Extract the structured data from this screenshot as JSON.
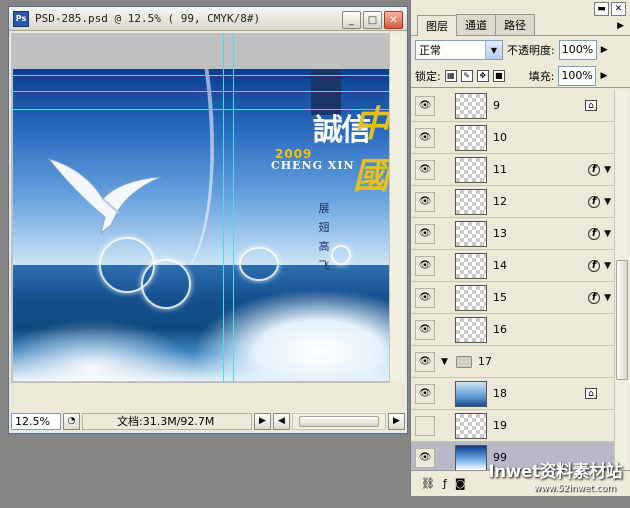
{
  "document": {
    "title": "PSD-285.psd @ 12.5% ( 99, CMYK/8#)",
    "logo": "Ps",
    "win_minimize": "_",
    "win_maximize": "□",
    "win_close": "✕",
    "artwork": {
      "year": "2009",
      "brand": "CHENG XIN",
      "title_white": "誠信",
      "title_gold": "中國",
      "vertical_text": [
        "展",
        "翅",
        "高",
        "飞"
      ]
    },
    "status": {
      "zoom": "12.5%",
      "doc_info": "文档:31.3M/92.7M"
    }
  },
  "palette": {
    "tabs": [
      {
        "label": "图层",
        "active": true
      },
      {
        "label": "通道",
        "active": false
      },
      {
        "label": "路径",
        "active": false
      }
    ],
    "blend_mode": "正常",
    "opacity_label": "不透明度:",
    "opacity_value": "100%",
    "lock_label": "锁定:",
    "fill_label": "填充:",
    "fill_value": "100%",
    "layers": [
      {
        "name": "9",
        "visible": true,
        "fx": false,
        "lock": true,
        "thumb": "transparent"
      },
      {
        "name": "10",
        "visible": true,
        "fx": false,
        "lock": false,
        "thumb": "transparent"
      },
      {
        "name": "11",
        "visible": true,
        "fx": true,
        "lock": false,
        "thumb": "transparent"
      },
      {
        "name": "12",
        "visible": true,
        "fx": true,
        "lock": false,
        "thumb": "transparent"
      },
      {
        "name": "13",
        "visible": true,
        "fx": true,
        "lock": false,
        "thumb": "transparent"
      },
      {
        "name": "14",
        "visible": true,
        "fx": true,
        "lock": false,
        "thumb": "transparent"
      },
      {
        "name": "15",
        "visible": true,
        "fx": true,
        "lock": false,
        "thumb": "transparent"
      },
      {
        "name": "16",
        "visible": true,
        "fx": false,
        "lock": false,
        "thumb": "transparent"
      },
      {
        "name": "17",
        "visible": true,
        "fx": false,
        "lock": false,
        "thumb": "folder"
      },
      {
        "name": "18",
        "visible": true,
        "fx": false,
        "lock": true,
        "thumb": "sea"
      },
      {
        "name": "19",
        "visible": false,
        "fx": false,
        "lock": false,
        "thumb": "transparent"
      },
      {
        "name": "99",
        "visible": true,
        "fx": false,
        "lock": false,
        "thumb": "background",
        "selected": true
      }
    ]
  },
  "watermark": {
    "text": "Inwet资料素材站",
    "url": "www.52inwet.com"
  },
  "colors": {
    "guide": "#3fe0e6",
    "accent_gold": "#e3c020",
    "selection": "#b8b8c8"
  }
}
